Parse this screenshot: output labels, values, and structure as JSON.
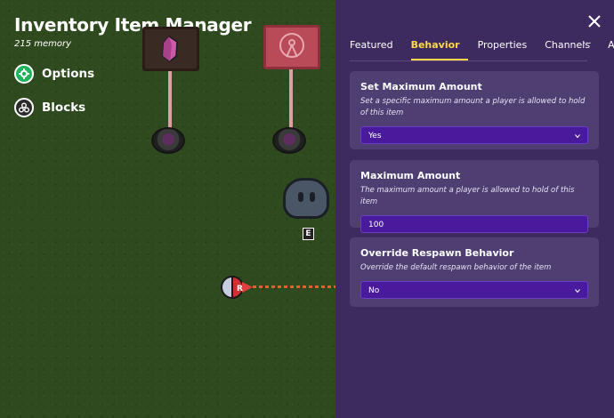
{
  "world": {
    "title": "Inventory Item Manager",
    "memory": "215 memory",
    "options_label": "Options",
    "blocks_label": "Blocks",
    "key_hint": "E"
  },
  "panel": {
    "tabs": [
      {
        "label": "Featured",
        "active": false
      },
      {
        "label": "Behavior",
        "active": true
      },
      {
        "label": "Properties",
        "active": false
      },
      {
        "label": "Channels",
        "active": false
      },
      {
        "label": "A",
        "active": false
      }
    ],
    "more_label": "···",
    "sections": [
      {
        "title": "Set Maximum Amount",
        "description": "Set a specific maximum amount a player is allowed to hold of this item",
        "value": "Yes",
        "type": "select"
      },
      {
        "title": "Maximum Amount",
        "description": "The maximum amount a player is allowed to hold of this item",
        "value": "100",
        "type": "input"
      },
      {
        "title": "Override Respawn Behavior",
        "description": "Override the default respawn behavior of the item",
        "value": "No",
        "type": "select"
      }
    ]
  },
  "colors": {
    "panel_bg": "#3d2a5e",
    "card_bg": "#4e3e72",
    "field_bg": "#4a1a9c",
    "active_tab": "#ffd84a",
    "grass": "#2f4a1f"
  }
}
